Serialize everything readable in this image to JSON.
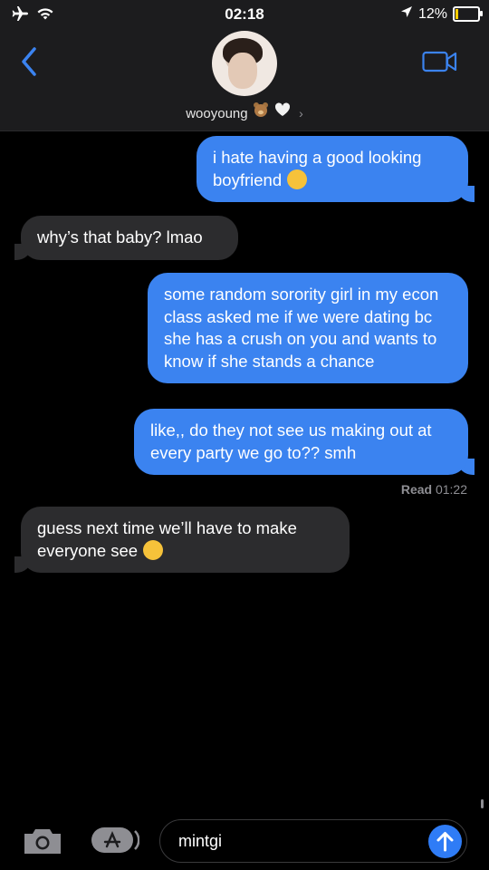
{
  "status_bar": {
    "time": "02:18",
    "battery": "12%",
    "battery_fraction": 0.12
  },
  "header": {
    "contact_name": "wooyoung"
  },
  "messages": [
    {
      "sender": "me",
      "text": "i hate having a good looking boyfriend"
    },
    {
      "sender": "them",
      "text": "why’s that baby? lmao"
    },
    {
      "sender": "me",
      "text": "some random sorority girl in my econ class asked me if we were dating bc she has a crush on you and wants to know if she stands a chance"
    },
    {
      "sender": "me",
      "text": "like,, do they not see us making out at every party we go to?? smh"
    },
    {
      "sender": "them",
      "text": "guess next time we’ll have to make everyone see"
    }
  ],
  "read_receipt": {
    "label": "Read",
    "time": "01:22"
  },
  "composer": {
    "value": "mintgi"
  },
  "colors": {
    "sent": "#3b83f0",
    "received": "#2c2c2e",
    "accent": "#2f7cf6"
  },
  "icons": [
    "airplane-icon",
    "wifi-icon",
    "location-icon",
    "battery-icon",
    "back-chevron-icon",
    "video-camera-icon",
    "bear-emoji-icon",
    "white-heart-icon",
    "camera-icon",
    "app-store-icon",
    "send-arrow-icon"
  ]
}
